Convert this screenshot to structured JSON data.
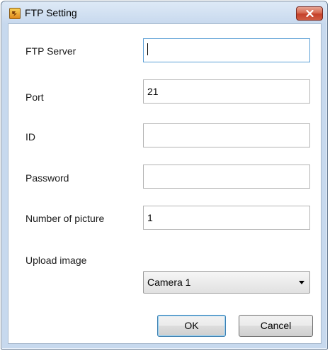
{
  "window": {
    "title": "FTP Setting",
    "icon": "app-icon",
    "close_icon": "close-icon"
  },
  "form": {
    "ftp_server": {
      "label": "FTP Server",
      "value": ""
    },
    "port": {
      "label": "Port",
      "value": "21"
    },
    "id": {
      "label": "ID",
      "value": ""
    },
    "password": {
      "label": "Password",
      "value": ""
    },
    "number_of_picture": {
      "label": "Number of picture",
      "value": "1"
    },
    "upload_image": {
      "label": "Upload image",
      "selected": "Camera 1"
    }
  },
  "buttons": {
    "ok": "OK",
    "cancel": "Cancel"
  },
  "colors": {
    "window_frame": "#c7d9ee",
    "close_button": "#c5412a",
    "focus_border": "#5c9fd6"
  }
}
